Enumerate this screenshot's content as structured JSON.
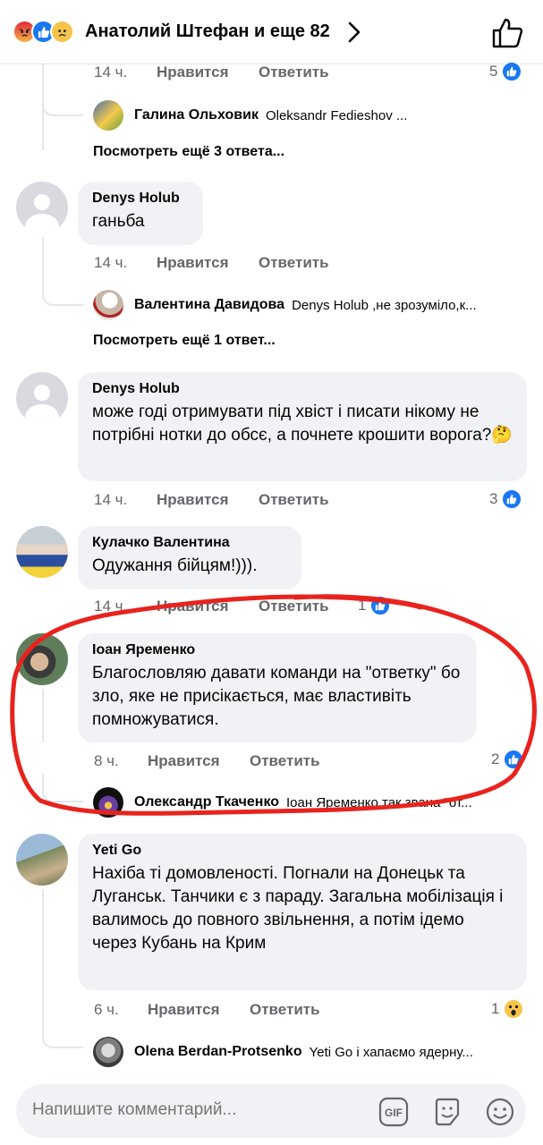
{
  "header": {
    "title": "Анатолий Штефан и еще 82",
    "reactions": [
      "angry-reaction-icon",
      "like-reaction-icon",
      "sad-reaction-icon"
    ]
  },
  "labels": {
    "like": "Нравится",
    "reply": "Ответить"
  },
  "thread0": {
    "time": "14 ч.",
    "reaction_count": "5",
    "reply": {
      "name": "Галина Ольховик",
      "text": "Oleksandr Fedieshov ..."
    },
    "more_replies": "Посмотреть ещё 3 ответа..."
  },
  "comments": [
    {
      "author": "Denys Holub",
      "text": "ганьба",
      "time": "14 ч.",
      "reply": {
        "name": "Валентина Давидова",
        "text": "Denys Holub ,не зрозуміло,к..."
      },
      "more_replies": "Посмотреть ещё 1 ответ..."
    },
    {
      "author": "Denys Holub",
      "text": "може годі отримувати під хвіст і писати нікому не потрібні нотки до обсє, а почнете крошити ворога?🤔",
      "time": "14 ч.",
      "reaction_count": "3"
    },
    {
      "author": "Кулачко Валентина",
      "text": "Одужання бійцям!))).",
      "time": "14 ч.",
      "reaction_count": "1"
    },
    {
      "author": "Іоан Яременко",
      "text": "Благословляю давати команди на \"ответку\" бо зло, яке не присікається, має властивіть помножуватися.",
      "time": "8 ч.",
      "reaction_count": "2",
      "reply": {
        "name": "Олександр Ткаченко",
        "text": "Іоан Яременко так звана \"от..."
      }
    },
    {
      "author": "Yeti Go",
      "text": "Нахіба ті домовленості. Погнали на Донецьк та Луганськ. Танчики є з параду. Загальна мобілізація і валимось до повного звільнення, а потім ідемо через Кубань на Крим",
      "time": "6 ч.",
      "reaction_count": "1",
      "reply": {
        "name": "Olena Berdan-Protsenko",
        "text": "Yeti Go і хапаємо ядерну..."
      }
    }
  ],
  "composer": {
    "placeholder": "Напишите комментарий...",
    "icons": [
      "gif-icon",
      "sticker-icon",
      "emoji-icon"
    ]
  },
  "colors": {
    "accent": "#1877f2",
    "bubble": "#f0f2f5",
    "secondary_text": "#65676b",
    "annotation": "#e8231e"
  }
}
